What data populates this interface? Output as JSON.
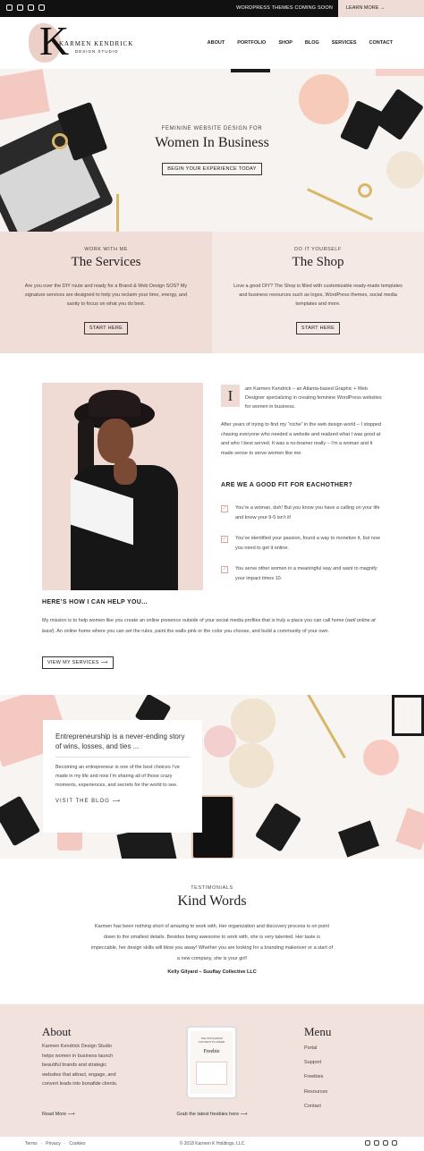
{
  "topbar": {
    "icons": [
      "instagram-icon",
      "facebook-icon",
      "youtube-icon",
      "mail-icon"
    ],
    "promo": "WORDPRESS THEMES COMING SOON",
    "learn_more": "LEARN MORE →"
  },
  "logo": {
    "name": "KARMEN KENDRICK",
    "sub": "DESIGN STUDIO",
    "monogram": "K"
  },
  "nav": [
    "ABOUT",
    "PORTFOLIO",
    "SHOP",
    "BLOG",
    "SERVICES",
    "CONTACT"
  ],
  "hero": {
    "eyebrow": "FEMININE WEBSITE DESIGN FOR",
    "title": "Women In Business",
    "button": "BEGIN YOUR EXPERIENCE TODAY"
  },
  "services": {
    "eyebrow": "WORK WITH ME",
    "title": "The Services",
    "body": "Are you over the DIY route and ready for a Brand & Web Design SOS? My signature services are designed to help you reclaim your time, energy, and sanity to focus on what you do best.",
    "button": "START HERE"
  },
  "shop": {
    "eyebrow": "DO IT YOURSELF",
    "title": "The Shop",
    "body": "Love a good DIY? The Shop is filled with customizable ready-made templates and business resources such as logos, WordPress themes, social media templates and more.",
    "button": "START HERE"
  },
  "about": {
    "dropcap": "I",
    "intro": "am Karmen Kendrick – an Atlanta-based Graphic + Web Designer specializing in creating feminine WordPress websites for women in business.",
    "p2": "After years of trying to find my “niche” in the web design world – I stopped chasing everyone who needed a website and realized what I was good at and who I best served. It was a no-brainer really – I’m a woman and it made sense to serve women like me.",
    "fit_title": "ARE WE A GOOD FIT FOR EACHOTHER?",
    "fit_items": [
      "You’re a woman, duh! But you know you have a calling on your life and know your 9-5 isn’t it!",
      "You’ve identified your passion, found a way to monetize it, but now you need to get it online.",
      "You serve other women in a meaningful way and want to magnify your impact times 10."
    ],
    "help_title": "HERE’S HOW I CAN HELP YOU...",
    "help_body_1": "My mission is to help women like you create an online presence outside of your social media profiles that is truly a place you can call home (",
    "help_body_em": "well online at least",
    "help_body_2": "). An online home where you can set the rules, paint the walls pink or the color you choose, and build a community of your own.",
    "help_button": "VIEW MY SERVICES ⟶"
  },
  "blog": {
    "title": "Entrepreneurship is a never-ending story of wins, losses, and ties ...",
    "body": "Becoming an entrepreneur is one of the best choices I’ve made in my life and now I’m sharing all of those crazy moments, experiences, and secrets for the world to see.",
    "link": "VISIT THE BLOG ⟶"
  },
  "testimonials": {
    "eyebrow": "TESTIMONIALS",
    "title": "Kind Words",
    "body": "Karmen has been nothing short of amazing to work with. Her organization and discovery process is on point down to the smallest details. Besides being awesome to work with, she is very talented. Her taste is impeccable, her design skills will blow you away! Whether you are looking for a branding makeover or a start of a new company, she is your girl!",
    "author": "Kelly Gilyard – Suuflay Collective LLC"
  },
  "footer": {
    "about_title": "About",
    "about_body": "Karmen Kendrick Design Studio helps women in business launch beautiful brands and strategic websites that attract, engage, and convert leads into bonafide clients.",
    "read_more": "Read More ⟶",
    "tablet_small": "THE INSTAGRAM CONTENT PLANNER",
    "tablet_script": "Freebie",
    "grab": "Grab the latest freebies here ⟶",
    "menu_title": "Menu",
    "menu": [
      "Portal",
      "Support",
      "Freebies",
      "Resources",
      "Contact"
    ]
  },
  "bottombar": {
    "links": [
      "Terms",
      "Privacy",
      "Cookies"
    ],
    "copyright": "© 2018 Karmen K Holdings, LLC",
    "icons": [
      "instagram-icon",
      "facebook-icon",
      "youtube-icon",
      "mail-icon"
    ]
  },
  "colors": {
    "blush": "#f1ddd7",
    "blush_light": "#f5e9e5",
    "ink": "#111111",
    "gold": "#d9b768"
  }
}
